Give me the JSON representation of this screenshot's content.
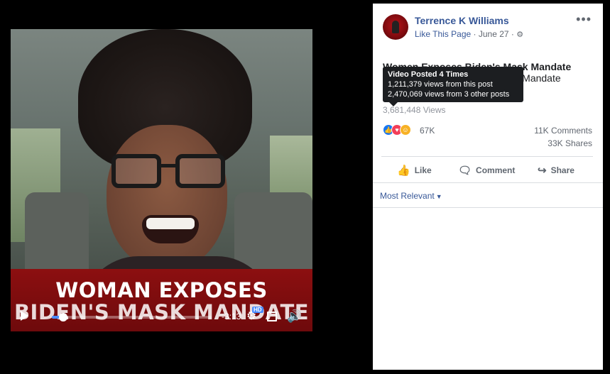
{
  "video": {
    "banner_line_1": "WOMAN EXPOSES",
    "banner_line_2": "BIDEN'S MASK MANDATE",
    "time_remaining": "-3:13",
    "hd_badge": "HD",
    "progress_fraction": 0.07,
    "icons": {
      "play": "play-icon",
      "settings": "gear-icon",
      "fullscreen": "fullscreen-icon",
      "volume": "volume-icon"
    }
  },
  "post": {
    "author": "Terrence K Williams",
    "like_page": "Like This Page",
    "date": "June 27",
    "title": "Women Exposes Biden's Mask Mandate",
    "subtitle": "Women Exposes Biden's Mask Mandate",
    "tooltip": {
      "title": "Video Posted 4 Times",
      "line1": "1,211,379 views from this post",
      "line2": "2,470,069 views from 3 other posts"
    },
    "views": "3,681,448 Views",
    "reactions_count": "67K",
    "comments": "11K Comments",
    "shares": "33K Shares",
    "actions": {
      "like": "Like",
      "comment": "Comment",
      "share": "Share"
    },
    "sort_label": "Most Relevant",
    "colors": {
      "link": "#385898",
      "like_blue": "#1877f2",
      "love_red": "#f33e58",
      "haha_yellow": "#f7b125"
    }
  }
}
